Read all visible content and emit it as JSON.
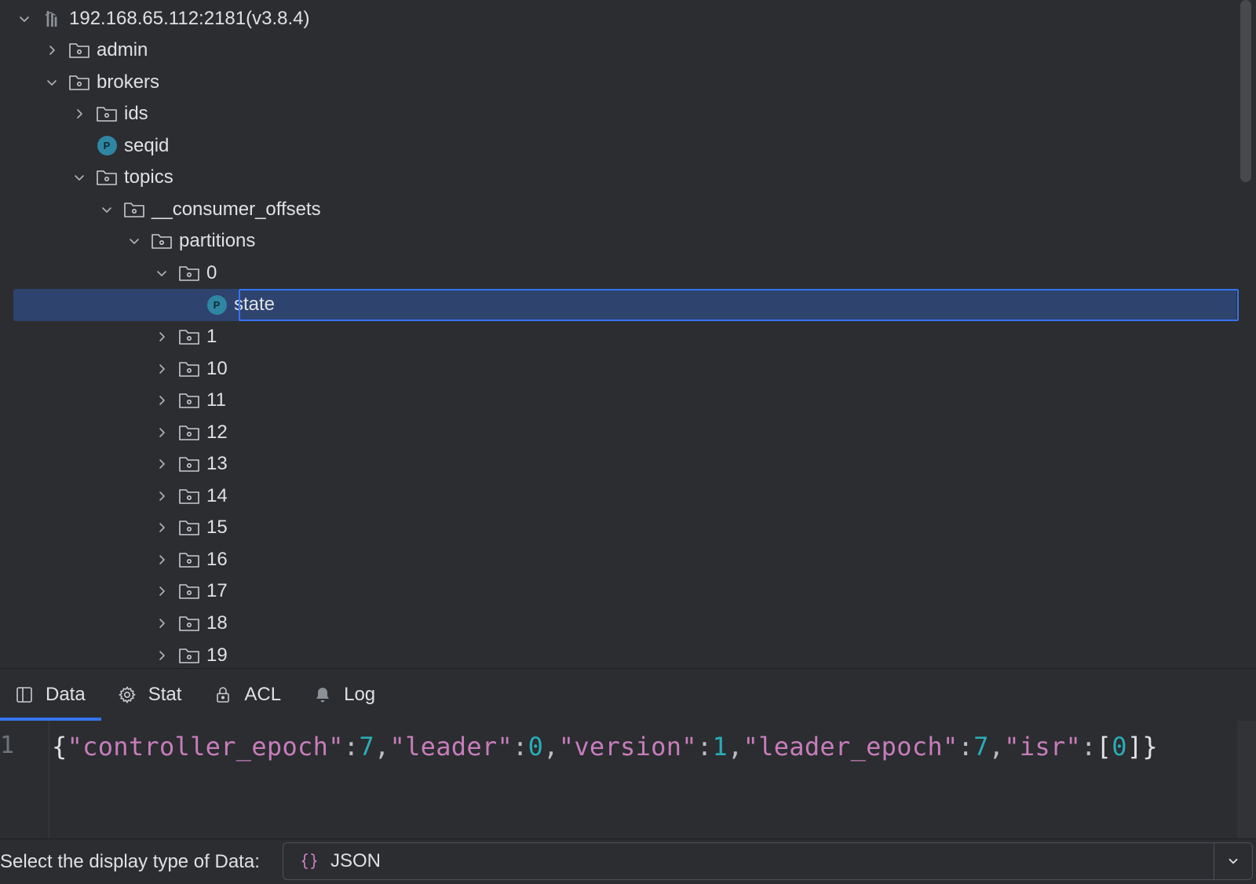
{
  "tree": {
    "rows": [
      {
        "label": "192.168.65.112:2181(v3.8.4)",
        "kind": "server",
        "expanded": true,
        "depth": 0,
        "icon": "server-icon"
      },
      {
        "label": "admin",
        "kind": "folder",
        "expanded": false,
        "depth": 1,
        "icon": "folder-icon"
      },
      {
        "label": "brokers",
        "kind": "folder",
        "expanded": true,
        "depth": 1,
        "icon": "folder-icon"
      },
      {
        "label": "ids",
        "kind": "folder",
        "expanded": false,
        "depth": 2,
        "icon": "folder-icon"
      },
      {
        "label": "seqid",
        "kind": "persistent",
        "depth": 2,
        "icon": "persistent-node-icon"
      },
      {
        "label": "topics",
        "kind": "folder",
        "expanded": true,
        "depth": 2,
        "icon": "folder-icon"
      },
      {
        "label": "__consumer_offsets",
        "kind": "folder",
        "expanded": true,
        "depth": 3,
        "icon": "folder-icon"
      },
      {
        "label": "partitions",
        "kind": "folder",
        "expanded": true,
        "depth": 4,
        "icon": "folder-icon"
      },
      {
        "label": "0",
        "kind": "folder",
        "expanded": true,
        "depth": 5,
        "icon": "folder-icon"
      },
      {
        "label": "state",
        "kind": "persistent",
        "depth": 6,
        "icon": "persistent-node-icon",
        "selected": true
      },
      {
        "label": "1",
        "kind": "folder",
        "expanded": false,
        "depth": 5,
        "icon": "folder-icon"
      },
      {
        "label": "10",
        "kind": "folder",
        "expanded": false,
        "depth": 5,
        "icon": "folder-icon"
      },
      {
        "label": "11",
        "kind": "folder",
        "expanded": false,
        "depth": 5,
        "icon": "folder-icon"
      },
      {
        "label": "12",
        "kind": "folder",
        "expanded": false,
        "depth": 5,
        "icon": "folder-icon"
      },
      {
        "label": "13",
        "kind": "folder",
        "expanded": false,
        "depth": 5,
        "icon": "folder-icon"
      },
      {
        "label": "14",
        "kind": "folder",
        "expanded": false,
        "depth": 5,
        "icon": "folder-icon"
      },
      {
        "label": "15",
        "kind": "folder",
        "expanded": false,
        "depth": 5,
        "icon": "folder-icon"
      },
      {
        "label": "16",
        "kind": "folder",
        "expanded": false,
        "depth": 5,
        "icon": "folder-icon"
      },
      {
        "label": "17",
        "kind": "folder",
        "expanded": false,
        "depth": 5,
        "icon": "folder-icon"
      },
      {
        "label": "18",
        "kind": "folder",
        "expanded": false,
        "depth": 5,
        "icon": "folder-icon"
      },
      {
        "label": "19",
        "kind": "folder",
        "expanded": false,
        "depth": 5,
        "icon": "folder-icon"
      }
    ],
    "persistent_badge": "P"
  },
  "tabs": [
    {
      "label": "Data",
      "icon": "panel-icon",
      "active": true
    },
    {
      "label": "Stat",
      "icon": "gear-icon",
      "active": false
    },
    {
      "label": "ACL",
      "icon": "lock-icon",
      "active": false
    },
    {
      "label": "Log",
      "icon": "bell-icon",
      "active": false
    }
  ],
  "editor": {
    "line_number": "1",
    "tokens": [
      {
        "t": "{",
        "c": "brace"
      },
      {
        "t": "\"controller_epoch\"",
        "c": "key"
      },
      {
        "t": ":",
        "c": "punc"
      },
      {
        "t": "7",
        "c": "num"
      },
      {
        "t": ",",
        "c": "punc"
      },
      {
        "t": "\"leader\"",
        "c": "key"
      },
      {
        "t": ":",
        "c": "punc"
      },
      {
        "t": "0",
        "c": "num"
      },
      {
        "t": ",",
        "c": "punc"
      },
      {
        "t": "\"version\"",
        "c": "key"
      },
      {
        "t": ":",
        "c": "punc"
      },
      {
        "t": "1",
        "c": "num"
      },
      {
        "t": ",",
        "c": "punc"
      },
      {
        "t": "\"leader_epoch\"",
        "c": "key"
      },
      {
        "t": ":",
        "c": "punc"
      },
      {
        "t": "7",
        "c": "num"
      },
      {
        "t": ",",
        "c": "punc"
      },
      {
        "t": "\"isr\"",
        "c": "key"
      },
      {
        "t": ":",
        "c": "punc"
      },
      {
        "t": "[",
        "c": "brace"
      },
      {
        "t": "0",
        "c": "num"
      },
      {
        "t": "]",
        "c": "brace"
      },
      {
        "t": "}",
        "c": "brace"
      }
    ]
  },
  "display_type": {
    "label": "Select the display type of Data:",
    "selected": "JSON",
    "icon": "braces-icon"
  },
  "colors": {
    "background": "#2b2d30",
    "selection": "#2e436e",
    "accent": "#3574f0",
    "json_key": "#c77dbb",
    "json_number": "#2aacb8",
    "badge": "#2f86a3"
  }
}
